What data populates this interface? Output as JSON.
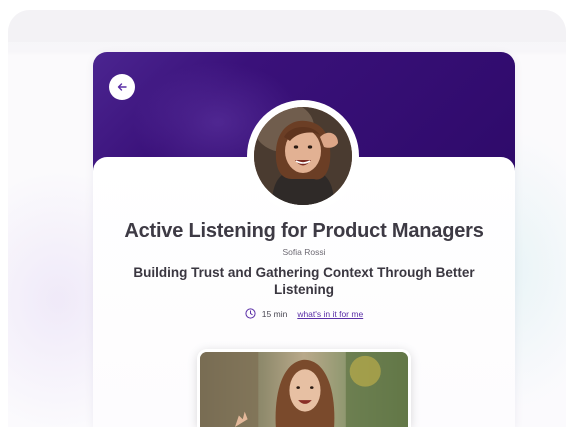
{
  "course": {
    "title": "Active Listening for Product Managers",
    "author": "Sofia Rossi",
    "subtitle": "Building Trust and Gathering Context Through Better Listening",
    "duration": "15 min",
    "link_label": "what's in it for me"
  },
  "icons": {
    "back": "arrow-left-icon",
    "clock": "clock-icon"
  },
  "colors": {
    "header_purple": "#2e0a6a",
    "accent": "#5a2ea6",
    "title_text": "#3d3a44"
  }
}
